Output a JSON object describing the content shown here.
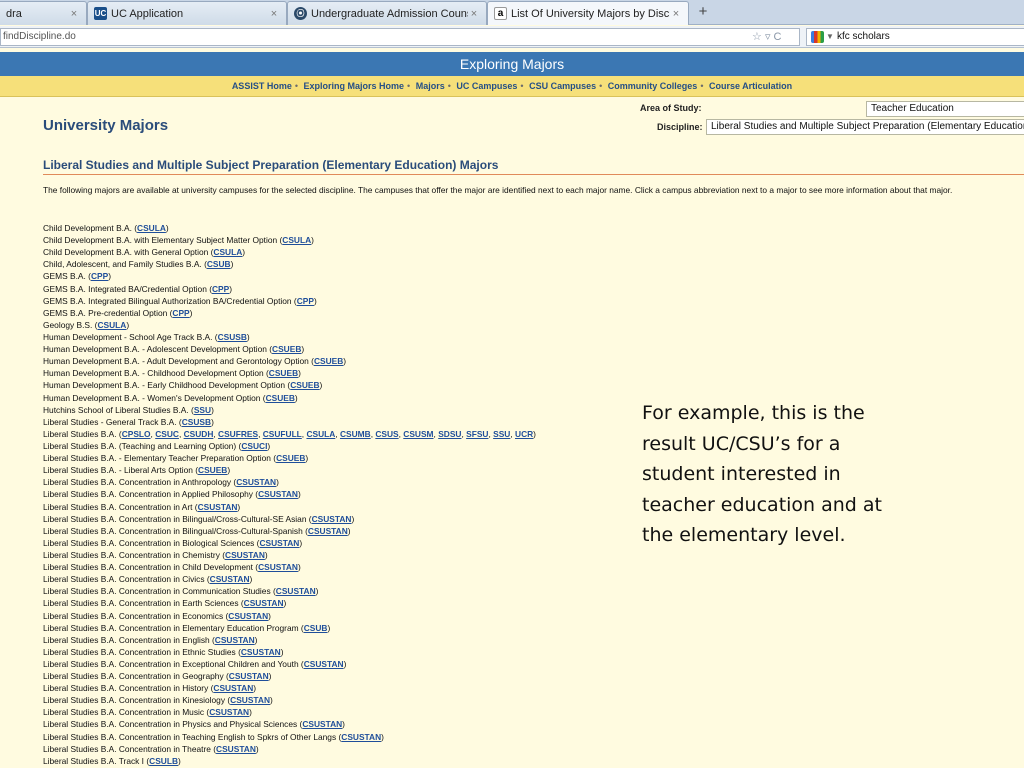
{
  "browser": {
    "tabs": [
      {
        "label": "dra",
        "favicon": "blank",
        "active": false,
        "close": "×"
      },
      {
        "label": "UC Application",
        "favicon": "uc-logo-icon",
        "active": false,
        "close": "×"
      },
      {
        "label": "Undergraduate Admission Counselor...",
        "favicon": "circle-logo-icon",
        "active": false,
        "close": "×"
      },
      {
        "label": "List Of University Majors by Discipline",
        "favicon": "assist-a-icon",
        "active": true,
        "close": "×"
      }
    ],
    "new_tab": "+",
    "url": "findDiscipline.do",
    "search_text": "kfc scholars"
  },
  "header": {
    "banner_title": "Exploring Majors",
    "nav": [
      "ASSIST Home",
      "Exploring Majors Home",
      "Majors",
      "UC Campuses",
      "CSU Campuses",
      "Community Colleges",
      "Course Articulation"
    ],
    "nav_separator": "•"
  },
  "page": {
    "title": "University Majors",
    "area_label": "Area of Study:",
    "area_value": "Teacher Education",
    "discipline_label": "Discipline:",
    "discipline_value": "Liberal Studies and Multiple Subject Preparation (Elementary Education)",
    "section_title": "Liberal Studies and Multiple Subject Preparation (Elementary Education) Majors",
    "intro": "The following majors are available at university campuses for the selected discipline. The campuses that offer the major are identified next to each major name. Click a campus abbreviation next to a major to see more information about that major.",
    "majors": [
      {
        "name": "Child Development B.A.",
        "campuses": [
          "CSULA"
        ]
      },
      {
        "name": "Child Development B.A. with Elementary Subject Matter Option",
        "campuses": [
          "CSULA"
        ]
      },
      {
        "name": "Child Development B.A. with General Option",
        "campuses": [
          "CSULA"
        ]
      },
      {
        "name": "Child, Adolescent, and Family Studies B.A.",
        "campuses": [
          "CSUB"
        ]
      },
      {
        "name": "GEMS B.A.",
        "campuses": [
          "CPP"
        ]
      },
      {
        "name": "GEMS B.A. Integrated BA/Credential Option",
        "campuses": [
          "CPP"
        ]
      },
      {
        "name": "GEMS B.A. Integrated Bilingual Authorization BA/Credential Option",
        "campuses": [
          "CPP"
        ]
      },
      {
        "name": "GEMS B.A. Pre-credential Option",
        "campuses": [
          "CPP"
        ]
      },
      {
        "name": "Geology B.S.",
        "campuses": [
          "CSULA"
        ]
      },
      {
        "name": "Human Development - School Age Track B.A.",
        "campuses": [
          "CSUSB"
        ]
      },
      {
        "name": "Human Development B.A. - Adolescent Development Option",
        "campuses": [
          "CSUEB"
        ]
      },
      {
        "name": "Human Development B.A. - Adult Development and Gerontology Option",
        "campuses": [
          "CSUEB"
        ]
      },
      {
        "name": "Human Development B.A. - Childhood Development Option",
        "campuses": [
          "CSUEB"
        ]
      },
      {
        "name": "Human Development B.A. - Early Childhood Development Option",
        "campuses": [
          "CSUEB"
        ]
      },
      {
        "name": "Human Development B.A. - Women's Development Option",
        "campuses": [
          "CSUEB"
        ]
      },
      {
        "name": "Hutchins School of Liberal Studies B.A.",
        "campuses": [
          "SSU"
        ]
      },
      {
        "name": "Liberal Studies - General Track B.A.",
        "campuses": [
          "CSUSB"
        ]
      },
      {
        "name": "Liberal Studies B.A.",
        "campuses": [
          "CPSLO",
          "CSUC",
          "CSUDH",
          "CSUFRES",
          "CSUFULL",
          "CSULA",
          "CSUMB",
          "CSUS",
          "CSUSM",
          "SDSU",
          "SFSU",
          "SSU",
          "UCR"
        ]
      },
      {
        "name": "Liberal Studies B.A. (Teaching and Learning Option)",
        "campuses": [
          "CSUCI"
        ]
      },
      {
        "name": "Liberal Studies B.A. - Elementary Teacher Preparation Option",
        "campuses": [
          "CSUEB"
        ]
      },
      {
        "name": "Liberal Studies B.A. - Liberal Arts Option",
        "campuses": [
          "CSUEB"
        ]
      },
      {
        "name": "Liberal Studies B.A. Concentration in Anthropology",
        "campuses": [
          "CSUSTAN"
        ]
      },
      {
        "name": "Liberal Studies B.A. Concentration in Applied Philosophy",
        "campuses": [
          "CSUSTAN"
        ]
      },
      {
        "name": "Liberal Studies B.A. Concentration in Art",
        "campuses": [
          "CSUSTAN"
        ]
      },
      {
        "name": "Liberal Studies B.A. Concentration in Bilingual/Cross-Cultural-SE Asian",
        "campuses": [
          "CSUSTAN"
        ]
      },
      {
        "name": "Liberal Studies B.A. Concentration in Bilingual/Cross-Cultural-Spanish",
        "campuses": [
          "CSUSTAN"
        ]
      },
      {
        "name": "Liberal Studies B.A. Concentration in Biological Sciences",
        "campuses": [
          "CSUSTAN"
        ]
      },
      {
        "name": "Liberal Studies B.A. Concentration in Chemistry",
        "campuses": [
          "CSUSTAN"
        ]
      },
      {
        "name": "Liberal Studies B.A. Concentration in Child Development",
        "campuses": [
          "CSUSTAN"
        ]
      },
      {
        "name": "Liberal Studies B.A. Concentration in Civics",
        "campuses": [
          "CSUSTAN"
        ]
      },
      {
        "name": "Liberal Studies B.A. Concentration in Communication Studies",
        "campuses": [
          "CSUSTAN"
        ]
      },
      {
        "name": "Liberal Studies B.A. Concentration in Earth Sciences",
        "campuses": [
          "CSUSTAN"
        ]
      },
      {
        "name": "Liberal Studies B.A. Concentration in Economics",
        "campuses": [
          "CSUSTAN"
        ]
      },
      {
        "name": "Liberal Studies B.A. Concentration in Elementary Education Program",
        "campuses": [
          "CSUB"
        ]
      },
      {
        "name": "Liberal Studies B.A. Concentration in English",
        "campuses": [
          "CSUSTAN"
        ]
      },
      {
        "name": "Liberal Studies B.A. Concentration in Ethnic Studies",
        "campuses": [
          "CSUSTAN"
        ]
      },
      {
        "name": "Liberal Studies B.A. Concentration in Exceptional Children and Youth",
        "campuses": [
          "CSUSTAN"
        ]
      },
      {
        "name": "Liberal Studies B.A. Concentration in Geography",
        "campuses": [
          "CSUSTAN"
        ]
      },
      {
        "name": "Liberal Studies B.A. Concentration in History",
        "campuses": [
          "CSUSTAN"
        ]
      },
      {
        "name": "Liberal Studies B.A. Concentration in Kinesiology",
        "campuses": [
          "CSUSTAN"
        ]
      },
      {
        "name": "Liberal Studies B.A. Concentration in Music",
        "campuses": [
          "CSUSTAN"
        ]
      },
      {
        "name": "Liberal Studies B.A. Concentration in Physics and Physical Sciences",
        "campuses": [
          "CSUSTAN"
        ]
      },
      {
        "name": "Liberal Studies B.A. Concentration in Teaching English to Spkrs of Other Langs",
        "campuses": [
          "CSUSTAN"
        ]
      },
      {
        "name": "Liberal Studies B.A. Concentration in Theatre",
        "campuses": [
          "CSUSTAN"
        ]
      },
      {
        "name": "Liberal Studies B.A. Track I",
        "campuses": [
          "CSULB"
        ]
      }
    ]
  },
  "callout": "For example, this is the result UC/CSU’s for a student interested in teacher education and at the elementary level.",
  "colors": {
    "banner_blue": "#3b77b3",
    "nav_yellow": "#f6e07a",
    "page_bg": "#fffbe0",
    "heading_blue": "#2a4c7a",
    "link_blue": "#1f4e9a",
    "rule_orange": "#e08a5a"
  }
}
